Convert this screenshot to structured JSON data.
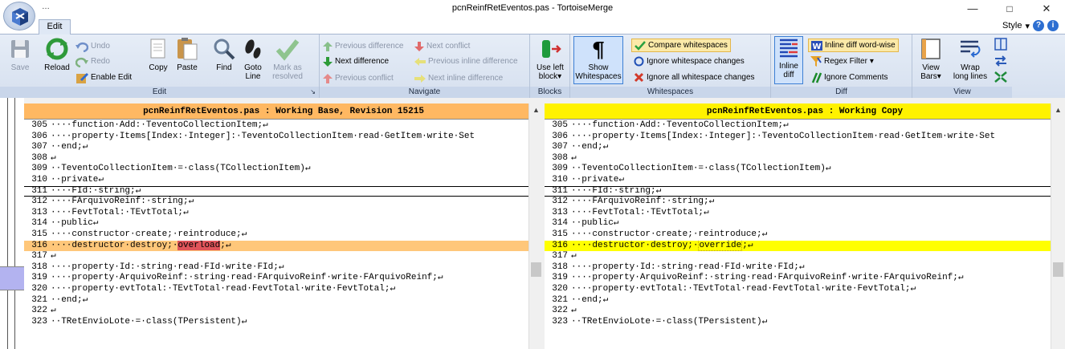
{
  "window": {
    "title": "pcnReinfRetEventos.pas - TortoiseMerge",
    "qat": "…",
    "min": "—",
    "max": "□",
    "close": "✕"
  },
  "tabs": {
    "edit": "Edit",
    "style": "Style",
    "style_arrow": "▾"
  },
  "ribbon": {
    "save": "Save",
    "reload": "Reload",
    "undo": "Undo",
    "redo": "Redo",
    "enable_edit": "Enable Edit",
    "copy": "Copy",
    "paste": "Paste",
    "find": "Find",
    "goto1": "Goto",
    "goto2": "Line",
    "markas1": "Mark as",
    "markas2": "resolved",
    "edit_group": "Edit",
    "prev_diff": "Previous difference",
    "next_diff": "Next difference",
    "prev_conflict": "Previous conflict",
    "next_conflict": "Next conflict",
    "prev_inline": "Previous inline difference",
    "next_inline": "Next inline difference",
    "navigate_group": "Navigate",
    "useleft1": "Use left",
    "useleft2": "block",
    "blocks_group": "Blocks",
    "show1": "Show",
    "show2": "Whitespaces",
    "compare_ws": "Compare whitespaces",
    "ignore_ws_changes": "Ignore whitespace changes",
    "ignore_all_ws": "Ignore all whitespace changes",
    "whitespaces_group": "Whitespaces",
    "inline1": "Inline",
    "inline2": "diff",
    "inline_word": "Inline diff word-wise",
    "regex_filter": "Regex Filter",
    "ignore_comments": "Ignore Comments",
    "diff_group": "Diff",
    "viewbars1": "View",
    "viewbars2": "Bars",
    "wrap1": "Wrap",
    "wrap2": "long lines",
    "view_group": "View"
  },
  "colors": {
    "left_header": "#ffb862",
    "right_header": "#fff200",
    "left_changed": "#ffc77a",
    "right_changed": "#ffff00",
    "left_word": "#e0545a",
    "right_word": "#ffff00",
    "ribbon_label": "#c9d6ea"
  },
  "left": {
    "header": "pcnReinfRetEventos.pas : Working Base, Revision 15215",
    "lines": [
      {
        "n": "305",
        "t": "····function·Add:·TeventoCollectionItem;↵",
        "s": ""
      },
      {
        "n": "306",
        "t": "····property·Items[Index:·Integer]:·TeventoCollectionItem·read·GetItem·write·Set",
        "s": ""
      },
      {
        "n": "307",
        "t": "··end;↵",
        "s": ""
      },
      {
        "n": "308",
        "t": "↵",
        "s": ""
      },
      {
        "n": "309",
        "t": "··TeventoCollectionItem·=·class(TCollectionItem)↵",
        "s": ""
      },
      {
        "n": "310",
        "t": "··private↵",
        "s": ""
      },
      {
        "n": "311",
        "t": "····FId:·string;↵",
        "s": "boxed"
      },
      {
        "n": "312",
        "t": "····FArquivoReinf:·string;↵",
        "s": ""
      },
      {
        "n": "313",
        "t": "····FevtTotal:·TEvtTotal;↵",
        "s": ""
      },
      {
        "n": "314",
        "t": "··public↵",
        "s": ""
      },
      {
        "n": "315",
        "t": "····constructor·create;·reintroduce;↵",
        "s": ""
      },
      {
        "n": "316",
        "t": "····destructor·destroy;·",
        "w": "overload",
        "e": ";↵",
        "s": "changed"
      },
      {
        "n": "317",
        "t": "↵",
        "s": ""
      },
      {
        "n": "318",
        "t": "····property·Id:·string·read·FId·write·FId;↵",
        "s": ""
      },
      {
        "n": "319",
        "t": "····property·ArquivoReinf:·string·read·FArquivoReinf·write·FArquivoReinf;↵",
        "s": ""
      },
      {
        "n": "320",
        "t": "····property·evtTotal:·TEvtTotal·read·FevtTotal·write·FevtTotal;↵",
        "s": ""
      },
      {
        "n": "321",
        "t": "··end;↵",
        "s": ""
      },
      {
        "n": "322",
        "t": "↵",
        "s": ""
      },
      {
        "n": "323",
        "t": "··TRetEnvioLote·=·class(TPersistent)↵",
        "s": ""
      }
    ]
  },
  "right": {
    "header": "pcnReinfRetEventos.pas : Working Copy",
    "lines": [
      {
        "n": "305",
        "t": "····function·Add:·TeventoCollectionItem;↵",
        "s": ""
      },
      {
        "n": "306",
        "t": "····property·Items[Index:·Integer]:·TeventoCollectionItem·read·GetItem·write·Set",
        "s": ""
      },
      {
        "n": "307",
        "t": "··end;↵",
        "s": ""
      },
      {
        "n": "308",
        "t": "↵",
        "s": ""
      },
      {
        "n": "309",
        "t": "··TeventoCollectionItem·=·class(TCollectionItem)↵",
        "s": ""
      },
      {
        "n": "310",
        "t": "··private↵",
        "s": ""
      },
      {
        "n": "311",
        "t": "····FId:·string;↵",
        "s": "boxed"
      },
      {
        "n": "312",
        "t": "····FArquivoReinf:·string;↵",
        "s": ""
      },
      {
        "n": "313",
        "t": "····FevtTotal:·TEvtTotal;↵",
        "s": ""
      },
      {
        "n": "314",
        "t": "··public↵",
        "s": ""
      },
      {
        "n": "315",
        "t": "····constructor·create;·reintroduce;↵",
        "s": ""
      },
      {
        "n": "316",
        "t": "····destructor·destroy;·",
        "w": "override",
        "e": ";↵",
        "s": "changed"
      },
      {
        "n": "317",
        "t": "↵",
        "s": ""
      },
      {
        "n": "318",
        "t": "····property·Id:·string·read·FId·write·FId;↵",
        "s": ""
      },
      {
        "n": "319",
        "t": "····property·ArquivoReinf:·string·read·FArquivoReinf·write·FArquivoReinf;↵",
        "s": ""
      },
      {
        "n": "320",
        "t": "····property·evtTotal:·TEvtTotal·read·FevtTotal·write·FevtTotal;↵",
        "s": ""
      },
      {
        "n": "321",
        "t": "··end;↵",
        "s": ""
      },
      {
        "n": "322",
        "t": "↵",
        "s": ""
      },
      {
        "n": "323",
        "t": "··TRetEnvioLote·=·class(TPersistent)↵",
        "s": ""
      }
    ]
  }
}
